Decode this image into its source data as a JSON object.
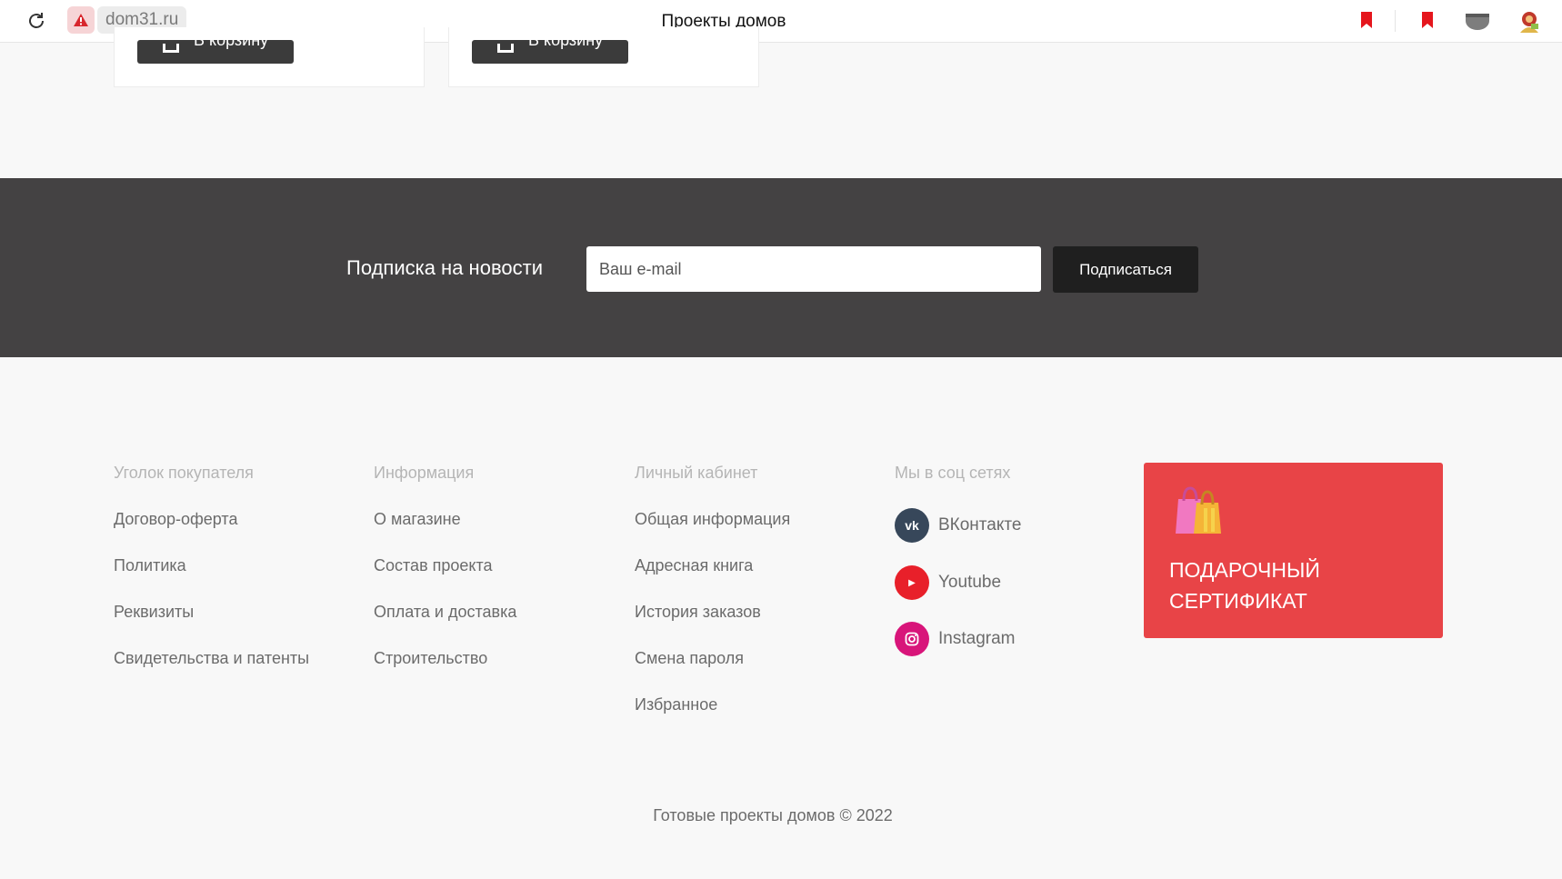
{
  "browser": {
    "domain": "dom31.ru",
    "page_title": "Проекты домов",
    "icons": [
      "reload-icon",
      "warning-icon",
      "bookmark-icon",
      "bookmark-filled-icon",
      "extension-icon",
      "avatar-icon"
    ]
  },
  "cards": {
    "cart_label": "В корзину"
  },
  "subscribe": {
    "label": "Подписка на новости",
    "email_placeholder": "Ваш e-mail",
    "email_value": "",
    "button": "Подписаться"
  },
  "footer": {
    "columns": [
      {
        "title": "Уголок покупателя",
        "items": [
          "Договор-оферта",
          "Политика",
          "Реквизиты",
          "Свидетельства и патенты"
        ]
      },
      {
        "title": "Информация",
        "items": [
          "О магазине",
          "Состав проекта",
          "Оплата и доставка",
          "Строительство"
        ]
      },
      {
        "title": "Личный кабинет",
        "items": [
          "Общая информация",
          "Адресная книга",
          "История заказов",
          "Смена пароля",
          "Избранное"
        ]
      }
    ],
    "social": {
      "title": "Мы в соц сетях",
      "items": [
        {
          "label": "ВКонтакте",
          "icon": "vk-icon",
          "color": "#37475a"
        },
        {
          "label": "Youtube",
          "icon": "youtube-icon",
          "color": "#e8202a"
        },
        {
          "label": "Instagram",
          "icon": "instagram-icon",
          "color": "#d8157a"
        }
      ]
    },
    "gift": {
      "line1": "ПОДАРОЧНЫЙ",
      "line2": "СЕРТИФИКАТ",
      "icon": "shopping-bags-icon",
      "color": "#e84447"
    },
    "copyright": "Готовые проекты домов © 2022"
  }
}
